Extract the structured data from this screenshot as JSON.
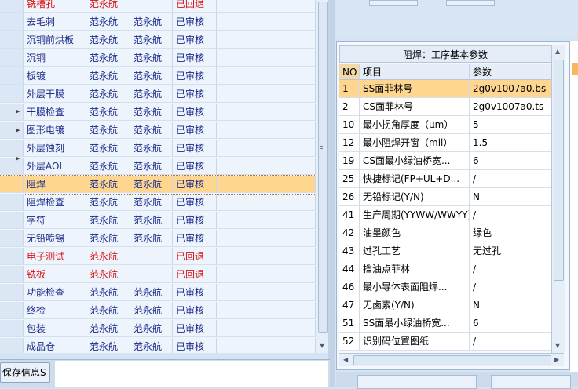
{
  "left_rows": [
    {
      "name": "铣槽孔",
      "p1": "范永航",
      "p2": "",
      "status": "已回退",
      "red": true
    },
    {
      "name": "去毛刺",
      "p1": "范永航",
      "p2": "范永航",
      "status": "已审核",
      "red": false
    },
    {
      "name": "沉铜前烘板",
      "p1": "范永航",
      "p2": "范永航",
      "status": "已审核",
      "red": false
    },
    {
      "name": "沉铜",
      "p1": "范永航",
      "p2": "范永航",
      "status": "已审核",
      "red": false
    },
    {
      "name": "板镀",
      "p1": "范永航",
      "p2": "范永航",
      "status": "已审核",
      "red": false
    },
    {
      "name": "外层干膜",
      "p1": "范永航",
      "p2": "范永航",
      "status": "已审核",
      "red": false
    },
    {
      "name": "干膜检查",
      "p1": "范永航",
      "p2": "范永航",
      "status": "已审核",
      "red": false
    },
    {
      "name": "图形电镀",
      "p1": "范永航",
      "p2": "范永航",
      "status": "已审核",
      "red": false
    },
    {
      "name": "外层蚀刻",
      "p1": "范永航",
      "p2": "范永航",
      "status": "已审核",
      "red": false
    },
    {
      "name": "外层AOI",
      "p1": "范永航",
      "p2": "范永航",
      "status": "已审核",
      "red": false
    },
    {
      "name": "阻焊",
      "p1": "范永航",
      "p2": "范永航",
      "status": "已审核",
      "red": false,
      "selected": true
    },
    {
      "name": "阻焊检查",
      "p1": "范永航",
      "p2": "范永航",
      "status": "已审核",
      "red": false
    },
    {
      "name": "字符",
      "p1": "范永航",
      "p2": "范永航",
      "status": "已审核",
      "red": false
    },
    {
      "name": "无铅喷锡",
      "p1": "范永航",
      "p2": "范永航",
      "status": "已审核",
      "red": false
    },
    {
      "name": "电子测试",
      "p1": "范永航",
      "p2": "",
      "status": "已回退",
      "red": true
    },
    {
      "name": "铣板",
      "p1": "范永航",
      "p2": "",
      "status": "已回退",
      "red": true
    },
    {
      "name": "功能检查",
      "p1": "范永航",
      "p2": "范永航",
      "status": "已审核",
      "red": false
    },
    {
      "name": "终检",
      "p1": "范永航",
      "p2": "范永航",
      "status": "已审核",
      "red": false
    },
    {
      "name": "包装",
      "p1": "范永航",
      "p2": "范永航",
      "status": "已审核",
      "red": false
    },
    {
      "name": "成品仓",
      "p1": "范永航",
      "p2": "范永航",
      "status": "已审核",
      "red": false
    }
  ],
  "bottom": {
    "save_tab": "保存信息S"
  },
  "param_grid": {
    "title": "阻焊：工序基本参数",
    "headers": {
      "no": "NO",
      "item": "项目",
      "param": "参数"
    },
    "rows": [
      {
        "no": "1",
        "item": "SS面菲林号",
        "param": "2g0v1007a0.bs",
        "selected": true
      },
      {
        "no": "2",
        "item": "CS面菲林号",
        "param": "2g0v1007a0.ts"
      },
      {
        "no": "10",
        "item": "最小拐角厚度（μm）",
        "param": "5"
      },
      {
        "no": "12",
        "item": "最小阻焊开窗（mil）",
        "param": "1.5"
      },
      {
        "no": "19",
        "item": "CS面最小绿油桥宽...",
        "param": "6"
      },
      {
        "no": "25",
        "item": "快捷标记(FP+UL+D...",
        "param": "/"
      },
      {
        "no": "26",
        "item": "无铅标记(Y/N)",
        "param": "N"
      },
      {
        "no": "41",
        "item": "生产周期(YYWW/WWYY)",
        "param": "/"
      },
      {
        "no": "42",
        "item": "油墨颜色",
        "param": "绿色"
      },
      {
        "no": "43",
        "item": "过孔工艺",
        "param": "无过孔"
      },
      {
        "no": "44",
        "item": "挡油点菲林",
        "param": "/"
      },
      {
        "no": "46",
        "item": "最小导体表面阻焊...",
        "param": "/"
      },
      {
        "no": "47",
        "item": "无卤素(Y/N)",
        "param": "N"
      },
      {
        "no": "51",
        "item": "SS面最小绿油桥宽...",
        "param": "6"
      },
      {
        "no": "52",
        "item": "识别码位置图纸",
        "param": "/"
      }
    ]
  }
}
